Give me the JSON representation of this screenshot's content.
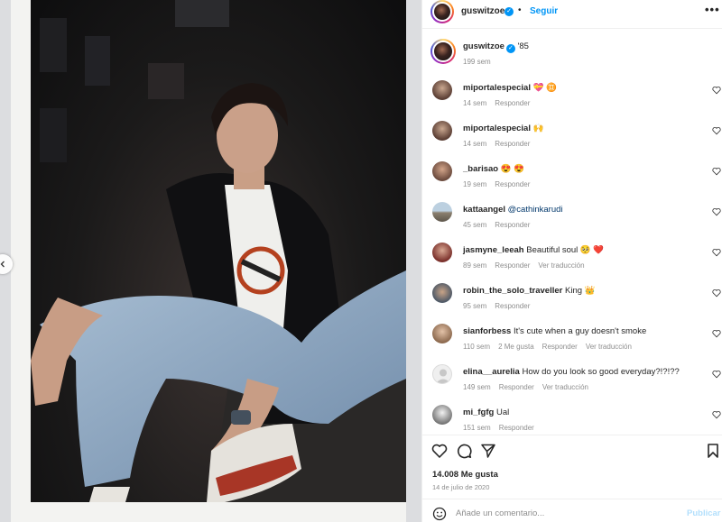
{
  "post": {
    "username": "guswitzoe",
    "follow_label": "Seguir",
    "separator": "•",
    "more_label": "•••",
    "verified_mark": "✓",
    "caption": {
      "text": "'85",
      "time": "199 sem"
    }
  },
  "comments": [
    {
      "username": "miportalespecial",
      "text": "💝 ♊",
      "time": "14 sem",
      "likes": "",
      "reply": "Responder",
      "translate": ""
    },
    {
      "username": "miportalespecial",
      "text": "🙌",
      "time": "14 sem",
      "likes": "",
      "reply": "Responder",
      "translate": ""
    },
    {
      "username": "_barisao",
      "text": "😍 😍",
      "time": "19 sem",
      "likes": "",
      "reply": "Responder",
      "translate": ""
    },
    {
      "username": "kattaangel",
      "text": "@cathinkarudi",
      "time": "45 sem",
      "likes": "",
      "reply": "Responder",
      "translate": ""
    },
    {
      "username": "jasmyne_leeah",
      "text": "Beautiful soul 🥺 ❤️",
      "time": "89 sem",
      "likes": "",
      "reply": "Responder",
      "translate": "Ver traducción"
    },
    {
      "username": "robin_the_solo_traveller",
      "text": "King 👑",
      "time": "95 sem",
      "likes": "",
      "reply": "Responder",
      "translate": ""
    },
    {
      "username": "sianforbess",
      "text": "It's cute when a guy doesn't smoke",
      "time": "110 sem",
      "likes": "2 Me gusta",
      "reply": "Responder",
      "translate": "Ver traducción"
    },
    {
      "username": "elina__aurelia",
      "text": "How do you look so good everyday?!?!??",
      "time": "149 sem",
      "likes": "",
      "reply": "Responder",
      "translate": "Ver traducción"
    },
    {
      "username": "mi_fgfg",
      "text": "Ual",
      "time": "151 sem",
      "likes": "",
      "reply": "Responder",
      "translate": ""
    }
  ],
  "footer": {
    "likes": "14.008 Me gusta",
    "date": "14 de julio de 2020",
    "comment_placeholder": "Añade un comentario...",
    "publish_label": "Publicar"
  },
  "icons": {
    "like": "heart-icon",
    "comment": "comment-icon",
    "share": "send-icon",
    "save": "bookmark-icon",
    "emoji": "emoji-icon",
    "prev": "chevron-left-icon",
    "more": "more-icon"
  },
  "colors": {
    "accent": "#0095f6",
    "text": "#262626",
    "secondary": "#8e8e8e",
    "publish_disabled": "#b2dffc"
  }
}
